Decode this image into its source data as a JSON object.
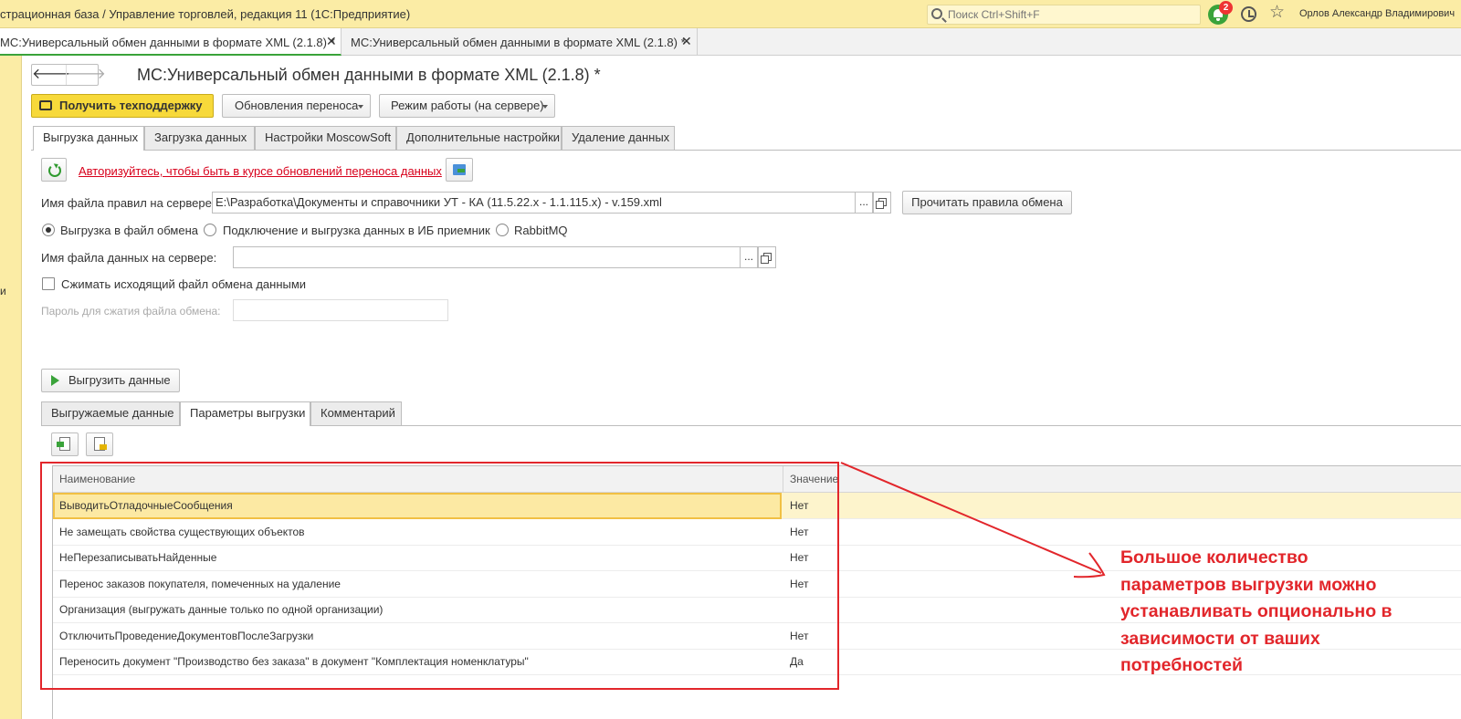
{
  "app": {
    "title": "страционная база / Управление торговлей, редакция 11  (1С:Предприятие)",
    "search_placeholder": "Поиск Ctrl+Shift+F",
    "notification_count": "2",
    "user": "Орлов Александр Владимирович"
  },
  "window_tabs": [
    {
      "label": "МС:Универсальный обмен данными в формате XML (2.1.8) *",
      "active": true
    },
    {
      "label": "МС:Универсальный обмен данными в формате XML (2.1.8) *",
      "active": false
    }
  ],
  "sidebar_fragment": "и",
  "page": {
    "title": "МС:Универсальный обмен данными в формате XML (2.1.8) *"
  },
  "commandbar": {
    "support": "Получить техподдержку",
    "updates": "Обновления переноса",
    "mode": "Режим работы (на сервере)"
  },
  "main_tabs": [
    "Выгрузка данных",
    "Загрузка данных",
    "Настройки MoscowSoft",
    "Дополнительные настройки",
    "Удаление данных"
  ],
  "auth_link": "Авторизуйтесь, чтобы быть в курсе обновлений переноса данных",
  "rules": {
    "label": "Имя файла правил на сервере:",
    "value": "E:\\Разработка\\Документы и справочники УТ - КА (11.5.22.x - 1.1.115.x) - v.159.xml",
    "choose": "...",
    "read_button": "Прочитать правила обмена"
  },
  "export_modes": [
    {
      "label": "Выгрузка в файл обмена",
      "selected": true
    },
    {
      "label": "Подключение и выгрузка данных в ИБ приемник",
      "selected": false
    },
    {
      "label": "RabbitMQ",
      "selected": false
    }
  ],
  "datafile": {
    "label": "Имя файла данных на сервере:",
    "value": "",
    "choose": "..."
  },
  "compress_label": "Сжимать исходящий файл обмена данными",
  "password_label": "Пароль для сжатия файла обмена:",
  "export_button": "Выгрузить данные",
  "sub_tabs": [
    "Выгружаемые данные",
    "Параметры выгрузки",
    "Комментарий"
  ],
  "table": {
    "headers": [
      "Наименование",
      "Значение"
    ],
    "rows": [
      {
        "name": "ВыводитьОтладочныеСообщения",
        "value": "Нет",
        "selected": true
      },
      {
        "name": "Не замещать свойства существующих объектов",
        "value": "Нет"
      },
      {
        "name": "НеПерезаписыватьНайденные",
        "value": "Нет"
      },
      {
        "name": "Перенос заказов покупателя, помеченных на удаление",
        "value": "Нет"
      },
      {
        "name": "Организация (выгружать данные только по одной организации)",
        "value": ""
      },
      {
        "name": "ОтключитьПроведениеДокументовПослеЗагрузки",
        "value": "Нет"
      },
      {
        "name": "Переносить документ \"Производство без заказа\" в документ \"Комплектация номенклатуры\"",
        "value": "Да"
      }
    ]
  },
  "annotation": {
    "lines": [
      "Большое количество",
      "параметров выгрузки можно",
      "устанавливать опционально в",
      "зависимости от ваших",
      "потребностей"
    ],
    "color": "#e2262b"
  }
}
